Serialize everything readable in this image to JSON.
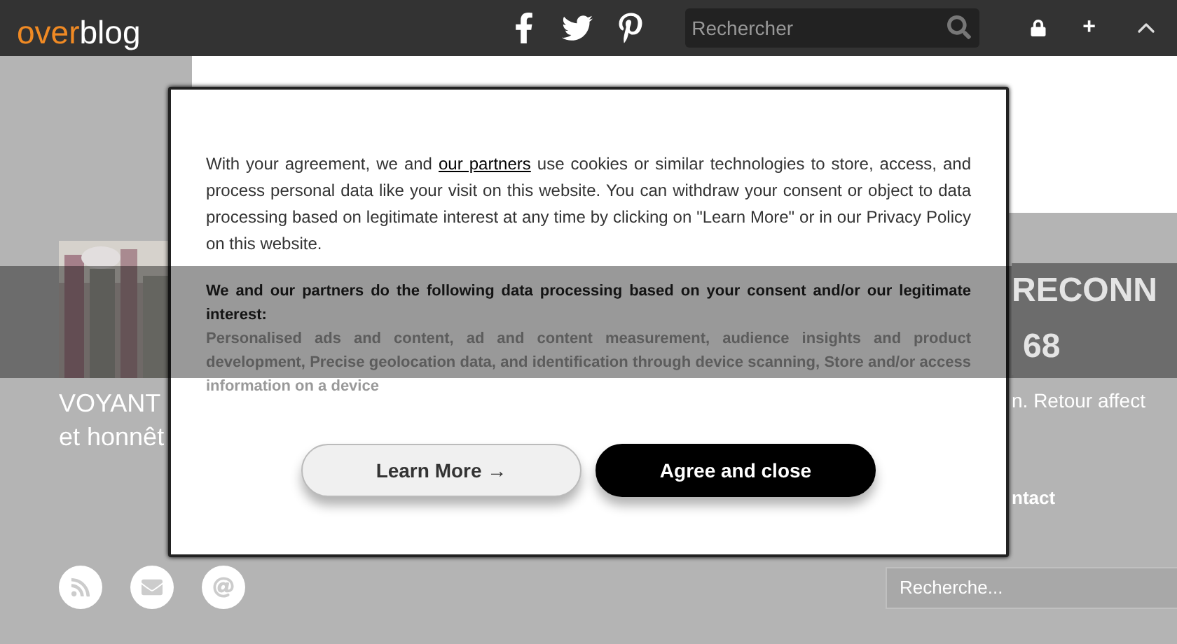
{
  "topbar": {
    "logo": {
      "first": "over",
      "second": "blog"
    },
    "search": {
      "placeholder": "Rechercher"
    },
    "plus": "+"
  },
  "left_column": {
    "texts": [
      "VOYANT",
      "et honnêt"
    ]
  },
  "right_column": {
    "title_lines": [
      "RECONN",
      "68"
    ],
    "text": "n. Retour affect",
    "link": "ntact"
  },
  "footer": {
    "search": {
      "placeholder": "Recherche..."
    }
  },
  "consent_dialog": {
    "intro": {
      "before": "With your agreement, we and ",
      "link": "our partners",
      "after": " use cookies or similar technologies to store, access, and process personal data like your visit on this website. You can withdraw your consent or object to data processing based on legitimate interest at any time by clicking on \"Learn More\" or in our Privacy Policy on this website."
    },
    "purposes_title": "We and our partners do the following data processing based on your consent and/or our legitimate interest:",
    "purposes": "Personalised ads and content, ad and content measurement, audience insights and product development, Precise geolocation data, and identification through device scanning, Store and/or access information on a device",
    "buttons": [
      {
        "label": "Learn More →",
        "kind": "secondary"
      },
      {
        "label": "Agree and close",
        "kind": "primary"
      }
    ]
  }
}
